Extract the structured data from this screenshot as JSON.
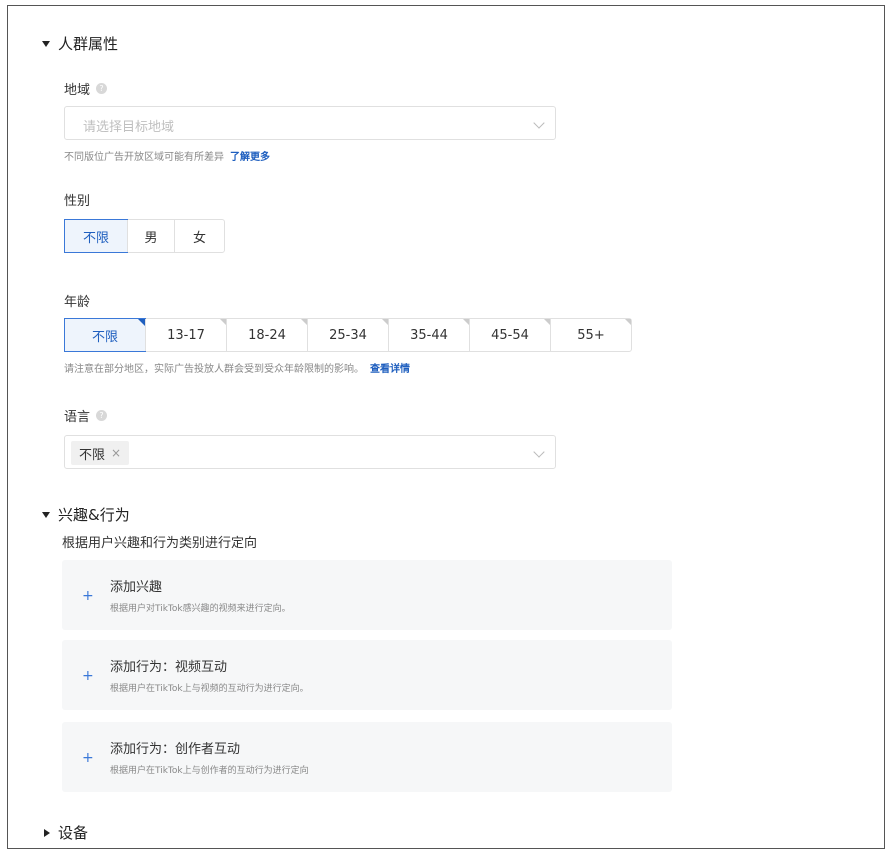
{
  "crowd": {
    "title": "人群属性",
    "region": {
      "label": "地域",
      "placeholder": "请选择目标地域",
      "hint": "不同版位广告开放区域可能有所差异",
      "hint_link": "了解更多"
    },
    "gender": {
      "label": "性别",
      "options": [
        "不限",
        "男",
        "女"
      ],
      "selected": "不限"
    },
    "age": {
      "label": "年龄",
      "options": [
        "不限",
        "13-17",
        "18-24",
        "25-34",
        "35-44",
        "45-54",
        "55+"
      ],
      "selected": "不限",
      "hint": "请注意在部分地区，实际广告投放人群会受到受众年龄限制的影响。",
      "hint_link": "查看详情"
    },
    "language": {
      "label": "语言",
      "tag": "不限",
      "tag_remove": "×"
    }
  },
  "interest": {
    "title": "兴趣&行为",
    "subtitle": "根据用户兴趣和行为类别进行定向",
    "cards": [
      {
        "title": "添加兴趣",
        "desc": "根据用户对TikTok感兴趣的视频来进行定向。"
      },
      {
        "title": "添加行为：视频互动",
        "desc": "根据用户在TikTok上与视频的互动行为进行定向。"
      },
      {
        "title": "添加行为：创作者互动",
        "desc": "根据用户在TikTok上与创作者的互动行为进行定向"
      }
    ],
    "plus_glyph": "+"
  },
  "device": {
    "title": "设备"
  },
  "colors": {
    "accent": "#1f5fbf",
    "active_bg": "#eef4fc",
    "card_bg": "#f6f7f8"
  }
}
